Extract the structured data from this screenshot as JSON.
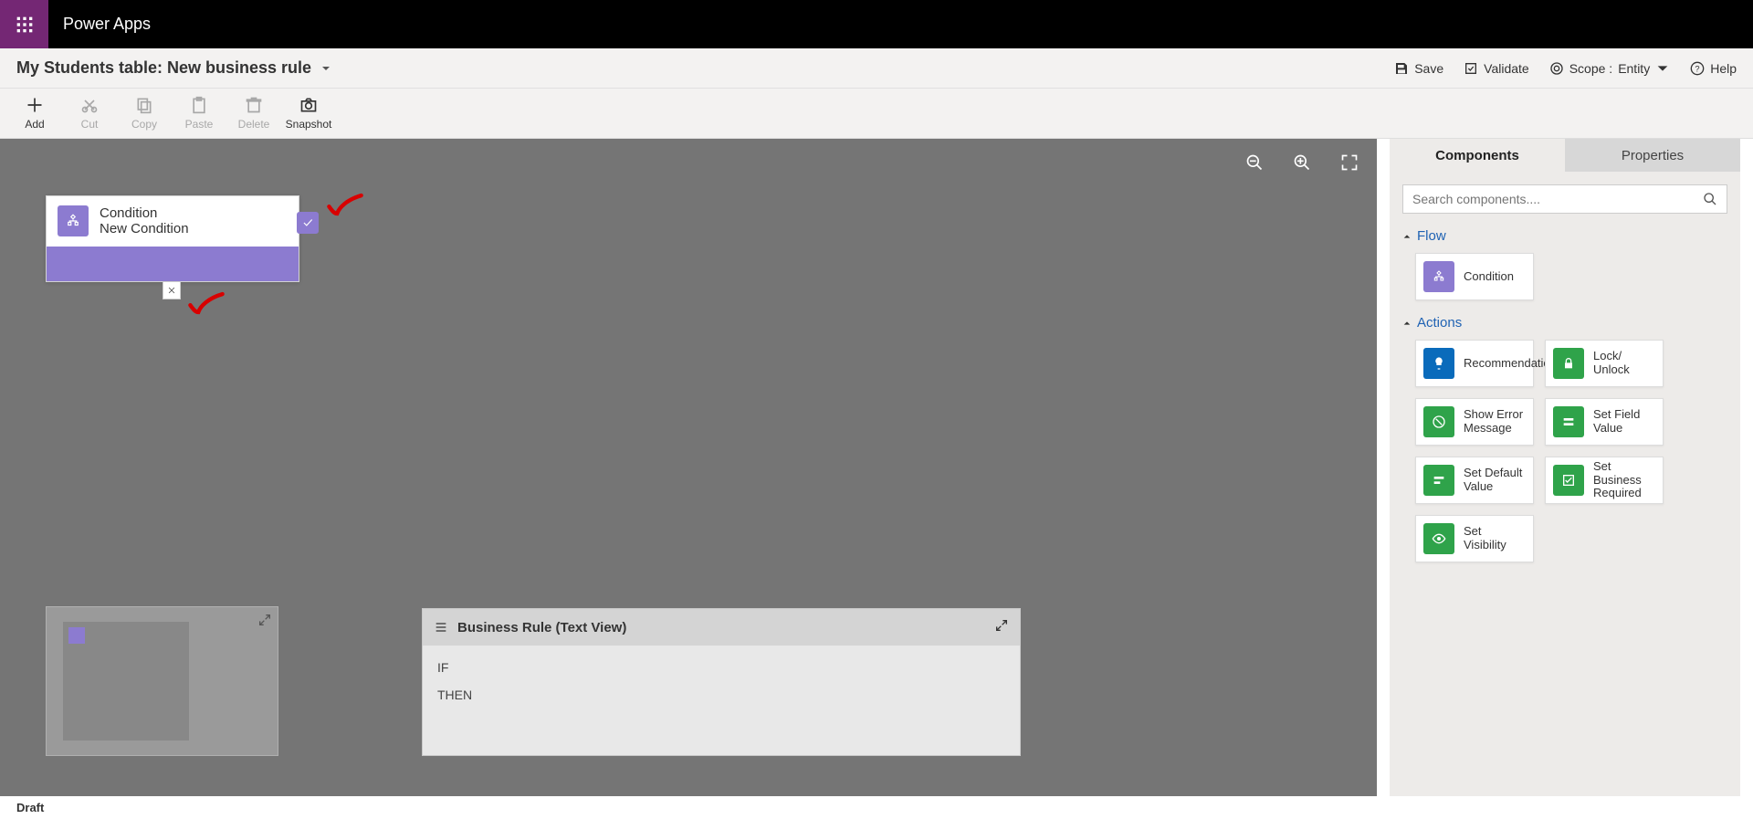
{
  "app_title": "Power Apps",
  "breadcrumb": "My Students table: New business rule",
  "header_actions": {
    "save": "Save",
    "validate": "Validate",
    "scope_label": "Scope :",
    "scope_value": "Entity",
    "help": "Help"
  },
  "toolbar": {
    "add": "Add",
    "cut": "Cut",
    "copy": "Copy",
    "paste": "Paste",
    "delete": "Delete",
    "snapshot": "Snapshot"
  },
  "canvas": {
    "node": {
      "type_label": "Condition",
      "name": "New Condition"
    },
    "textview": {
      "title": "Business Rule (Text View)",
      "if_label": "IF",
      "then_label": "THEN"
    }
  },
  "side": {
    "tabs": {
      "components": "Components",
      "properties": "Properties"
    },
    "search_placeholder": "Search components....",
    "sections": {
      "flow": "Flow",
      "actions": "Actions"
    },
    "components": {
      "condition": "Condition",
      "recommendation": "Recommendation",
      "lock_unlock": "Lock/ Unlock",
      "show_error": "Show Error Message",
      "set_field_value": "Set Field Value",
      "set_default_value": "Set Default Value",
      "set_business_required": "Set Business Required",
      "set_visibility": "Set Visibility"
    }
  },
  "status": "Draft"
}
